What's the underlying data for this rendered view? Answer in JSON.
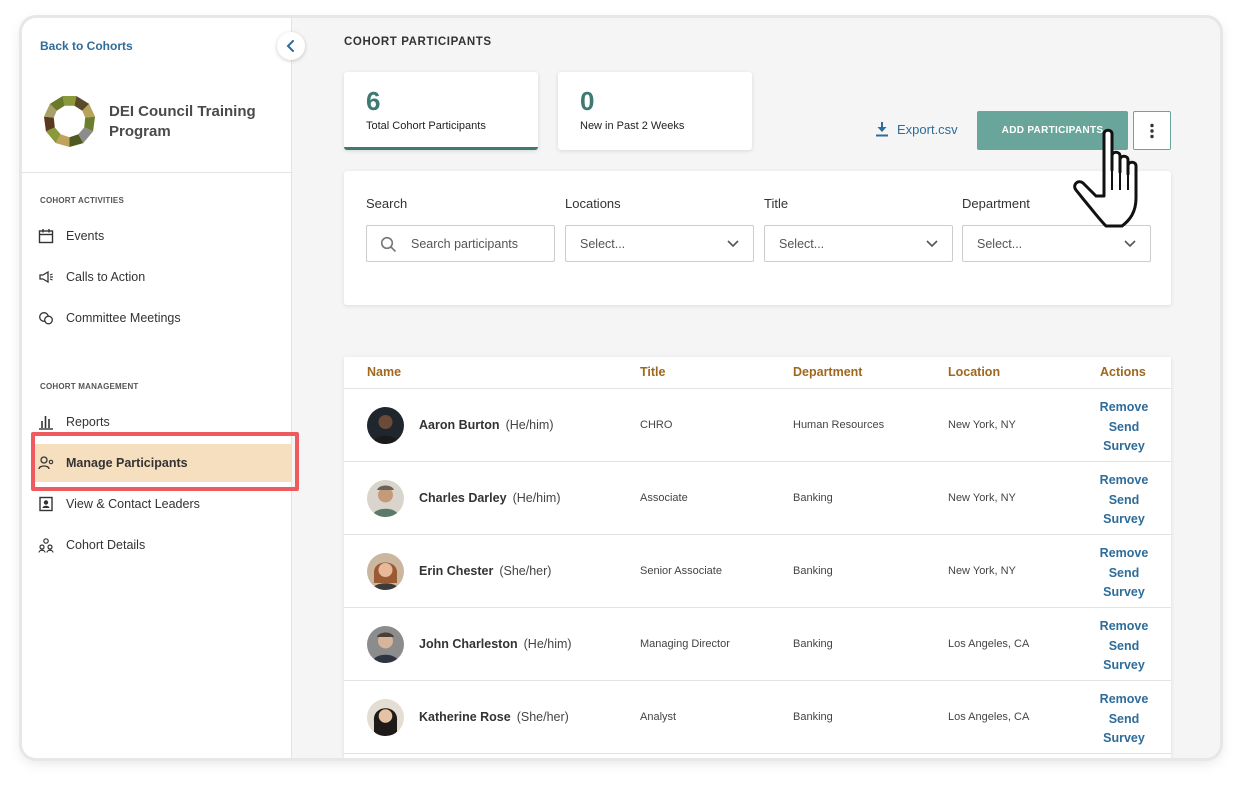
{
  "sidebar": {
    "back_link": "Back to Cohorts",
    "program_name": "DEI Council Training Program",
    "sections": [
      {
        "title": "COHORT ACTIVITIES"
      },
      {
        "title": "COHORT MANAGEMENT"
      }
    ],
    "items": [
      {
        "label": "Events",
        "icon": "calendar-icon"
      },
      {
        "label": "Calls to Action",
        "icon": "megaphone-icon"
      },
      {
        "label": "Committee Meetings",
        "icon": "meetings-icon"
      },
      {
        "label": "Reports",
        "icon": "bar-chart-icon"
      },
      {
        "label": "Manage Participants",
        "icon": "user-settings-icon",
        "active": true
      },
      {
        "label": "View & Contact Leaders",
        "icon": "contact-card-icon"
      },
      {
        "label": "Cohort Details",
        "icon": "group-icon"
      }
    ]
  },
  "main": {
    "title": "COHORT PARTICIPANTS",
    "stats": [
      {
        "value": "6",
        "label": "Total Cohort Participants"
      },
      {
        "value": "0",
        "label": "New in Past 2 Weeks"
      }
    ],
    "export_label": "Export.csv",
    "add_button": "ADD PARTICIPANTS",
    "filters": {
      "search": {
        "label": "Search",
        "placeholder": "Search participants"
      },
      "locations": {
        "label": "Locations",
        "value": "Select..."
      },
      "title": {
        "label": "Title",
        "value": "Select..."
      },
      "department": {
        "label": "Department",
        "value": "Select..."
      }
    },
    "table": {
      "headers": [
        "Name",
        "Title",
        "Department",
        "Location",
        "Actions"
      ],
      "action_labels": {
        "remove": "Remove",
        "send": "Send",
        "survey": "Survey"
      },
      "rows": [
        {
          "name": "Aaron Burton",
          "pronouns": "(He/him)",
          "title": "CHRO",
          "department": "Human Resources",
          "location": "New York, NY"
        },
        {
          "name": "Charles Darley",
          "pronouns": "(He/him)",
          "title": "Associate",
          "department": "Banking",
          "location": "New York, NY"
        },
        {
          "name": "Erin Chester",
          "pronouns": "(She/her)",
          "title": "Senior Associate",
          "department": "Banking",
          "location": "New York, NY"
        },
        {
          "name": "John Charleston",
          "pronouns": "(He/him)",
          "title": "Managing Director",
          "department": "Banking",
          "location": "Los Angeles, CA"
        },
        {
          "name": "Katherine Rose",
          "pronouns": "(She/her)",
          "title": "Analyst",
          "department": "Banking",
          "location": "Los Angeles, CA"
        }
      ]
    }
  },
  "colors": {
    "accent_teal": "#3f7a72",
    "button_teal": "#6aa59b",
    "link_blue": "#2e6c99",
    "header_brown": "#a0671f",
    "active_nav": "#f6dfbf",
    "highlight_red": "#ef5a5f"
  }
}
